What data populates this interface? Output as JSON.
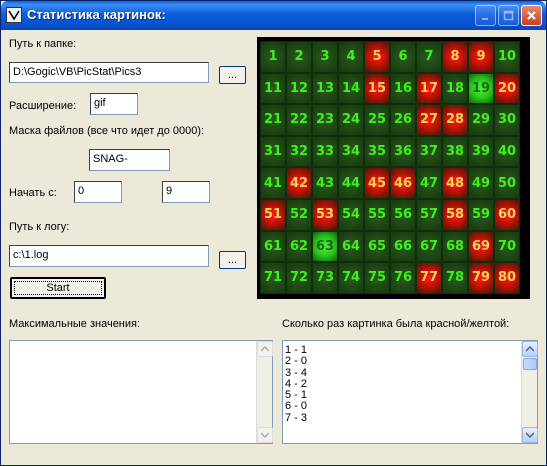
{
  "window": {
    "title": "Статистика картинок:",
    "buttons": {
      "minimize": "minimize",
      "maximize": "maximize",
      "close": "close"
    }
  },
  "form": {
    "folder_label": "Путь к папке:",
    "folder_value": "D:\\Gogic\\VB\\PicStat\\Pics3",
    "browse_label": "...",
    "ext_label": "Расширение:",
    "ext_value": "gif",
    "mask_label": "Маска файлов (все что идет до 0000):",
    "mask_value": "SNAG-",
    "start_label": "Начать с:",
    "start_from": "0",
    "start_to": "9",
    "log_label": "Путь к логу:",
    "log_value": "c:\\1.log",
    "log_browse_label": "...",
    "start_button": "Start",
    "max_label": "Максимальные значения:",
    "count_label": "Сколько раз картинка была красной/желтой:"
  },
  "grid": {
    "cells": [
      {
        "n": "1",
        "s": "g"
      },
      {
        "n": "2",
        "s": "g"
      },
      {
        "n": "3",
        "s": "g"
      },
      {
        "n": "4",
        "s": "g"
      },
      {
        "n": "5",
        "s": "r"
      },
      {
        "n": "6",
        "s": "g"
      },
      {
        "n": "7",
        "s": "g"
      },
      {
        "n": "8",
        "s": "r"
      },
      {
        "n": "9",
        "s": "r"
      },
      {
        "n": "10",
        "s": "g"
      },
      {
        "n": "11",
        "s": "g"
      },
      {
        "n": "12",
        "s": "g"
      },
      {
        "n": "13",
        "s": "g"
      },
      {
        "n": "14",
        "s": "g"
      },
      {
        "n": "15",
        "s": "r"
      },
      {
        "n": "16",
        "s": "g"
      },
      {
        "n": "17",
        "s": "r"
      },
      {
        "n": "18",
        "s": "g"
      },
      {
        "n": "19",
        "s": "l"
      },
      {
        "n": "20",
        "s": "r"
      },
      {
        "n": "21",
        "s": "g"
      },
      {
        "n": "22",
        "s": "g"
      },
      {
        "n": "23",
        "s": "g"
      },
      {
        "n": "24",
        "s": "g"
      },
      {
        "n": "25",
        "s": "g"
      },
      {
        "n": "26",
        "s": "g"
      },
      {
        "n": "27",
        "s": "r"
      },
      {
        "n": "28",
        "s": "r"
      },
      {
        "n": "29",
        "s": "g"
      },
      {
        "n": "30",
        "s": "g"
      },
      {
        "n": "31",
        "s": "g"
      },
      {
        "n": "32",
        "s": "g"
      },
      {
        "n": "33",
        "s": "g"
      },
      {
        "n": "34",
        "s": "g"
      },
      {
        "n": "35",
        "s": "g"
      },
      {
        "n": "36",
        "s": "g"
      },
      {
        "n": "37",
        "s": "g"
      },
      {
        "n": "38",
        "s": "g"
      },
      {
        "n": "39",
        "s": "g"
      },
      {
        "n": "40",
        "s": "g"
      },
      {
        "n": "41",
        "s": "g"
      },
      {
        "n": "42",
        "s": "r"
      },
      {
        "n": "43",
        "s": "g"
      },
      {
        "n": "44",
        "s": "g"
      },
      {
        "n": "45",
        "s": "r"
      },
      {
        "n": "46",
        "s": "r"
      },
      {
        "n": "47",
        "s": "g"
      },
      {
        "n": "48",
        "s": "r"
      },
      {
        "n": "49",
        "s": "g"
      },
      {
        "n": "50",
        "s": "g"
      },
      {
        "n": "51",
        "s": "r"
      },
      {
        "n": "52",
        "s": "g"
      },
      {
        "n": "53",
        "s": "r"
      },
      {
        "n": "54",
        "s": "g"
      },
      {
        "n": "55",
        "s": "g"
      },
      {
        "n": "56",
        "s": "g"
      },
      {
        "n": "57",
        "s": "g"
      },
      {
        "n": "58",
        "s": "r"
      },
      {
        "n": "59",
        "s": "g"
      },
      {
        "n": "60",
        "s": "r"
      },
      {
        "n": "61",
        "s": "g"
      },
      {
        "n": "62",
        "s": "g"
      },
      {
        "n": "63",
        "s": "l"
      },
      {
        "n": "64",
        "s": "g"
      },
      {
        "n": "65",
        "s": "g"
      },
      {
        "n": "66",
        "s": "g"
      },
      {
        "n": "67",
        "s": "g"
      },
      {
        "n": "68",
        "s": "g"
      },
      {
        "n": "69",
        "s": "r"
      },
      {
        "n": "70",
        "s": "g"
      },
      {
        "n": "71",
        "s": "g"
      },
      {
        "n": "72",
        "s": "g"
      },
      {
        "n": "73",
        "s": "g"
      },
      {
        "n": "74",
        "s": "g"
      },
      {
        "n": "75",
        "s": "g"
      },
      {
        "n": "76",
        "s": "g"
      },
      {
        "n": "77",
        "s": "r"
      },
      {
        "n": "78",
        "s": "g"
      },
      {
        "n": "79",
        "s": "r"
      },
      {
        "n": "80",
        "s": "r"
      }
    ]
  },
  "count_list": [
    "1 - 1",
    "2 - 0",
    "3 - 4",
    "4 - 2",
    "5 - 1",
    "6 - 0",
    "7 - 3"
  ],
  "colors": {
    "title_bar": "#0553d1",
    "cell_normal": "#1e4614",
    "cell_red": "#c21208",
    "cell_green": "#25c21a",
    "number_green": "#3ef01e",
    "number_yellow": "#ffd25a"
  },
  "icons": {
    "app": "checkbox-icon",
    "scroll_up": "arrow-up-icon",
    "scroll_down": "arrow-down-icon"
  }
}
